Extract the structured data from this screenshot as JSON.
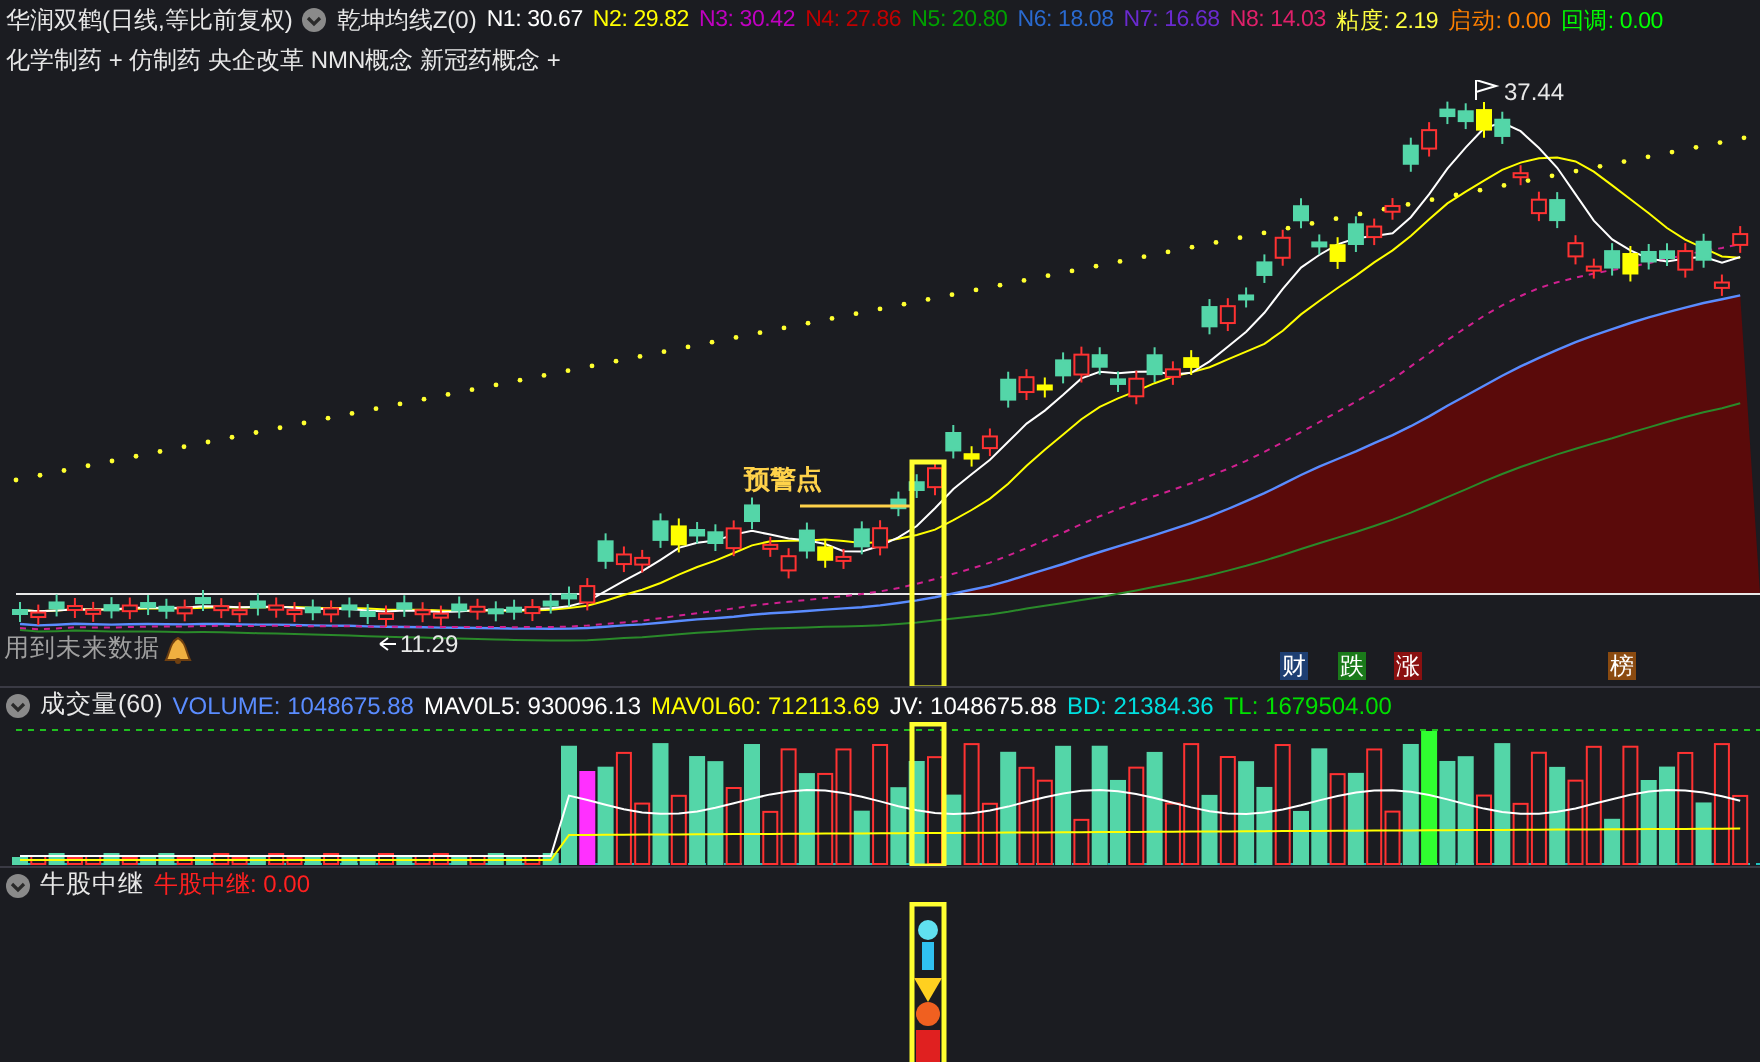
{
  "header": {
    "title": "华润双鹤(日线,等比前复权)",
    "indicator": "乾坤均线Z(0)",
    "values": [
      {
        "label": "N1: 30.67",
        "color": "#ffffff"
      },
      {
        "label": "N2: 29.82",
        "color": "#ffff00"
      },
      {
        "label": "N3: 30.42",
        "color": "#c000c0"
      },
      {
        "label": "N4: 27.86",
        "color": "#c00000"
      },
      {
        "label": "N5: 20.80",
        "color": "#00a000"
      },
      {
        "label": "N6: 18.08",
        "color": "#2a6ad0"
      },
      {
        "label": "N7: 16.68",
        "color": "#6a2ad0"
      },
      {
        "label": "N8: 14.03",
        "color": "#e0206a"
      },
      {
        "label": "粘度: 2.19",
        "color": "#ffff40"
      },
      {
        "label": "启动: 0.00",
        "color": "#ff8000"
      },
      {
        "label": "回调: 0.00",
        "color": "#00ff00"
      }
    ]
  },
  "concepts": "化学制药 + 仿制药 央企改革 NMN概念 新冠药概念 +",
  "main_chart": {
    "alert_label": "预警点",
    "high_label": "37.44",
    "low_label": "11.29",
    "warning_text": "用到未来数据",
    "event_tags": [
      {
        "text": "财",
        "color": "#1e3f73"
      },
      {
        "text": "跌",
        "color": "#1a7a1a"
      },
      {
        "text": "涨",
        "color": "#8a1010"
      },
      {
        "text": "榜",
        "color": "#8a4a10"
      }
    ]
  },
  "volume_panel": {
    "name": "成交量(60)",
    "values": [
      {
        "label": "VOLUME: 1048675.88",
        "color": "#5a8cff"
      },
      {
        "label": "MAV0L5: 930096.13",
        "color": "#ffffff"
      },
      {
        "label": "MAV0L60: 712113.69",
        "color": "#ffff00"
      },
      {
        "label": "JV: 1048675.88",
        "color": "#ffffff"
      },
      {
        "label": "BD: 21384.36",
        "color": "#00e0e0"
      },
      {
        "label": "TL: 1679504.00",
        "color": "#00e000"
      }
    ]
  },
  "signal_panel": {
    "name": "牛股中继",
    "values": [
      {
        "label": "牛股中继: 0.00",
        "color": "#ff2020"
      }
    ]
  }
}
